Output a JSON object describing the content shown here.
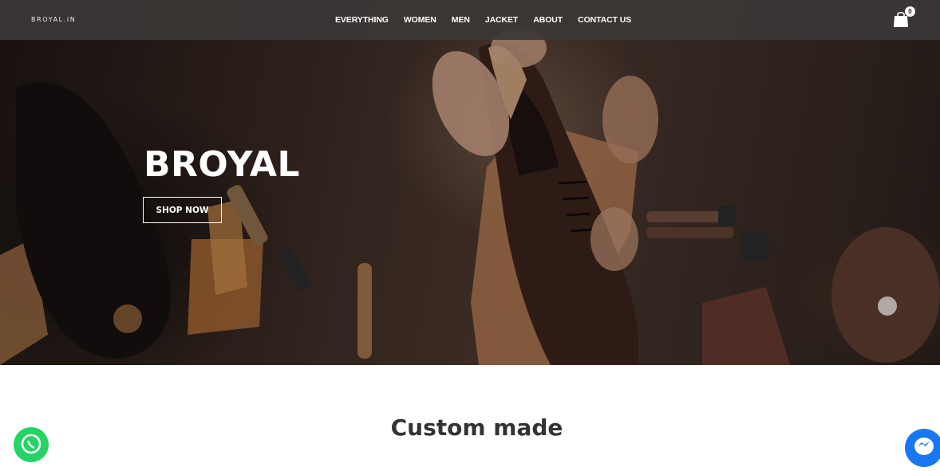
{
  "header": {
    "logo": "BROYAL.IN",
    "menu": [
      "EVERYTHING",
      "WOMEN",
      "MEN",
      "JACKET",
      "ABOUT",
      "CONTACT US"
    ],
    "cart_count": "0",
    "icons": [
      "shopping-bag-icon",
      "whatsapp-icon",
      "messenger-icon"
    ]
  },
  "hero": {
    "title": "BROYAL",
    "cta": "SHOP NOW"
  },
  "section": {
    "title": "Custom made"
  },
  "colors": {
    "nav_background": "#3c3736",
    "whatsapp": "#25d366",
    "messenger": "#1877f2"
  }
}
